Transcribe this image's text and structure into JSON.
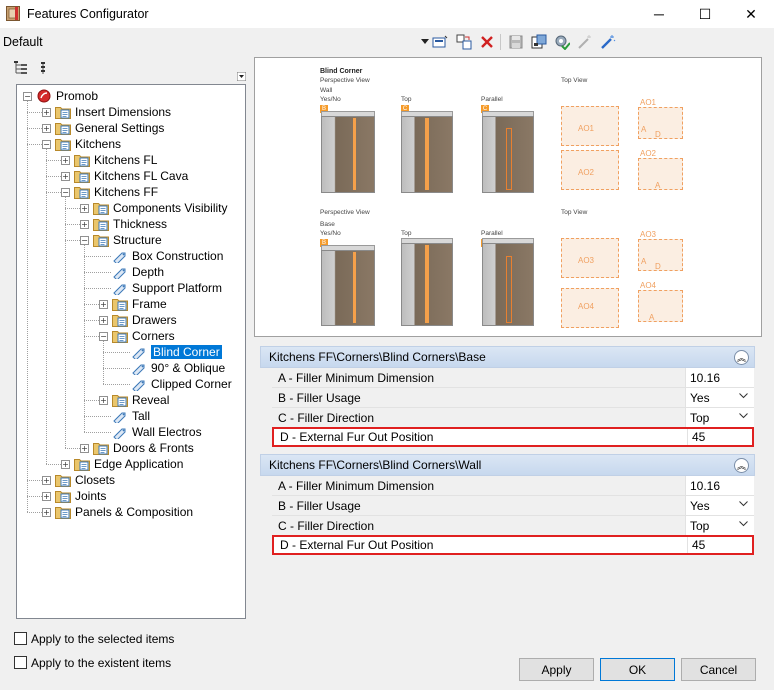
{
  "window": {
    "title": "Features Configurator",
    "minimize": "─",
    "maximize": "☐",
    "close": "✕"
  },
  "profile": "Default",
  "tree": [
    {
      "label": "Promob",
      "level": 0,
      "expander": "−"
    },
    {
      "label": "Insert Dimensions",
      "level": 1,
      "expander": "+"
    },
    {
      "label": "General Settings",
      "level": 1,
      "expander": "+"
    },
    {
      "label": "Kitchens",
      "level": 1,
      "expander": "−"
    },
    {
      "label": "Kitchens FL",
      "level": 2,
      "expander": "+"
    },
    {
      "label": "Kitchens FL Cava",
      "level": 2,
      "expander": "+"
    },
    {
      "label": "Kitchens FF",
      "level": 2,
      "expander": "−"
    },
    {
      "label": "Components Visibility",
      "level": 3,
      "expander": "+"
    },
    {
      "label": "Thickness",
      "level": 3,
      "expander": "+"
    },
    {
      "label": "Structure",
      "level": 3,
      "expander": "−"
    },
    {
      "label": "Box Construction",
      "level": 4,
      "expander": ""
    },
    {
      "label": "Depth",
      "level": 4,
      "expander": ""
    },
    {
      "label": "Support Platform",
      "level": 4,
      "expander": ""
    },
    {
      "label": "Frame",
      "level": 4,
      "expander": "+"
    },
    {
      "label": "Drawers",
      "level": 4,
      "expander": "+"
    },
    {
      "label": "Corners",
      "level": 4,
      "expander": "−"
    },
    {
      "label": "Blind Corner",
      "level": 5,
      "expander": "",
      "selected": true
    },
    {
      "label": "90° & Oblique",
      "level": 5,
      "expander": ""
    },
    {
      "label": "Clipped Corner",
      "level": 5,
      "expander": ""
    },
    {
      "label": "Reveal",
      "level": 4,
      "expander": "+"
    },
    {
      "label": "Tall",
      "level": 4,
      "expander": ""
    },
    {
      "label": "Wall Electros",
      "level": 4,
      "expander": ""
    },
    {
      "label": "Doors & Fronts",
      "level": 3,
      "expander": "+"
    },
    {
      "label": "Edge Application",
      "level": 2,
      "expander": "+"
    },
    {
      "label": "Closets",
      "level": 1,
      "expander": "+"
    },
    {
      "label": "Joints",
      "level": 1,
      "expander": "+"
    },
    {
      "label": "Panels & Composition",
      "level": 1,
      "expander": "+"
    }
  ],
  "preview": {
    "title": "Blind Corner",
    "perspective": "Perspective View",
    "top_view": "Top View",
    "wall": "Wall",
    "base": "Base",
    "yes_no": "Yes/No",
    "top": "Top",
    "parallel": "Parallel",
    "tag_b": "B",
    "tag_c": "C",
    "ao1": "AO1",
    "ao2": "AO2",
    "ao3": "AO3",
    "ao4": "AO4",
    "a": "A",
    "d": "D"
  },
  "sections": [
    {
      "title": "Kitchens FF\\Corners\\Blind Corners\\Base",
      "collapse": "︽",
      "rows": [
        {
          "label": "A - Filler Minimum Dimension",
          "value": "10.16",
          "dropdown": false,
          "highlight": false
        },
        {
          "label": "B - Filler Usage",
          "value": "Yes",
          "dropdown": true,
          "highlight": false
        },
        {
          "label": "C - Filler Direction",
          "value": "Top",
          "dropdown": true,
          "highlight": false
        },
        {
          "label": "D - External Fur Out Position",
          "value": "45",
          "dropdown": false,
          "highlight": true
        }
      ]
    },
    {
      "title": "Kitchens FF\\Corners\\Blind Corners\\Wall",
      "collapse": "︽",
      "rows": [
        {
          "label": "A - Filler Minimum Dimension",
          "value": "10.16",
          "dropdown": false,
          "highlight": false
        },
        {
          "label": "B - Filler Usage",
          "value": "Yes",
          "dropdown": true,
          "highlight": false
        },
        {
          "label": "C - Filler Direction",
          "value": "Top",
          "dropdown": true,
          "highlight": false
        },
        {
          "label": "D - External Fur Out Position",
          "value": "45",
          "dropdown": false,
          "highlight": true
        }
      ]
    }
  ],
  "checkboxes": {
    "selected_items": "Apply to the selected items",
    "existent_items": "Apply to the existent items"
  },
  "buttons": {
    "apply": "Apply",
    "ok": "OK",
    "cancel": "Cancel"
  },
  "colors": {
    "selection": "#0078d7",
    "highlight": "#e02020",
    "section_header": "#c7d8ee",
    "accent_orange": "#f59b2a"
  }
}
